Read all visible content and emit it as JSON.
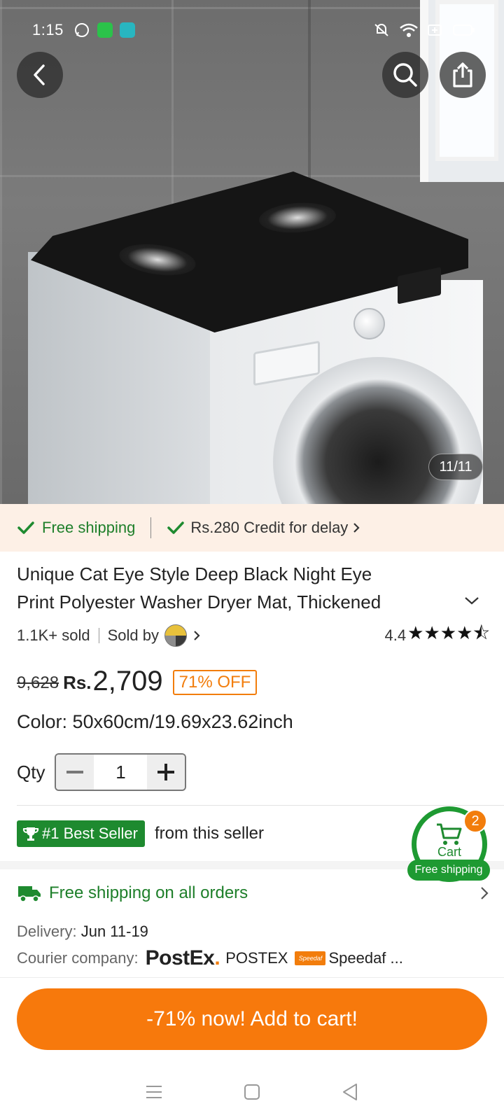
{
  "status_bar": {
    "time": "1:15",
    "icons": [
      "whatsapp-icon",
      "app-icon",
      "app-icon",
      "mute-icon",
      "wifi-icon",
      "battery-saver-icon",
      "battery-icon"
    ]
  },
  "gallery": {
    "counter": "11/11",
    "image_description_icon": "product-photo"
  },
  "shipping_banner": {
    "free_shipping": "Free shipping",
    "credit": "Rs.280 Credit for delay"
  },
  "product": {
    "title_line1": "Unique Cat Eye Style Deep Black Night Eye",
    "title_line2": "Print Polyester Washer Dryer Mat, Thickened",
    "sold": "1.1K+ sold",
    "sold_by": "Sold by",
    "rating": "4.4",
    "stars": "★★★★⯪",
    "rating_value": 4.4,
    "old_price": "9,628",
    "currency": "Rs.",
    "price": "2,709",
    "discount": "71% OFF",
    "color_label": "Color:",
    "color_value": "50x60cm/19.69x23.62inch",
    "qty_label": "Qty",
    "qty_value": "1",
    "qty_minus": "−",
    "qty_plus": "+"
  },
  "best_seller": {
    "badge": "#1 Best Seller",
    "text": "from this seller"
  },
  "delivery": {
    "free_shipping_all": "Free shipping on all orders",
    "delivery_label": "Delivery:",
    "delivery_value": "Jun 11-19",
    "courier_label": "Courier company:",
    "courier_logo_text": "PostEx",
    "courier1": "POSTEX",
    "courier2": "Speedaf ...",
    "speedaf_logo_text": "Speedaf"
  },
  "cart": {
    "label": "Cart",
    "count": "2",
    "free_shipping": "Free shipping"
  },
  "cta": {
    "label": "-71% now! Add to cart!"
  },
  "colors": {
    "accent_orange": "#f7790c",
    "green": "#1e8a2f",
    "banner_bg": "#fdf0e6"
  }
}
